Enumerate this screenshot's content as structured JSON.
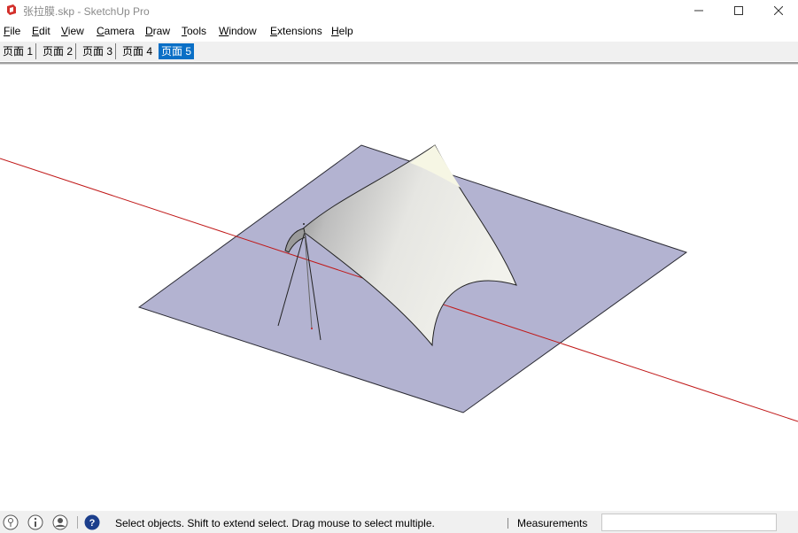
{
  "window": {
    "title": "张拉膜.skp - SketchUp Pro",
    "minimize_glyph": "—",
    "maximize_glyph": "☐",
    "close_glyph": "✕"
  },
  "menu": {
    "items": [
      {
        "accel": "F",
        "rest": "ile"
      },
      {
        "accel": "E",
        "rest": "dit"
      },
      {
        "accel": "V",
        "rest": "iew"
      },
      {
        "accel": "C",
        "rest": "amera"
      },
      {
        "accel": "D",
        "rest": "raw"
      },
      {
        "accel": "T",
        "rest": "ools"
      },
      {
        "accel": "W",
        "rest": "indow"
      },
      {
        "accel": "E",
        "rest": "xtensions"
      },
      {
        "accel": "H",
        "rest": "elp"
      }
    ]
  },
  "tabs": {
    "items": [
      "页面 1",
      "页面 2",
      "页面 3",
      "页面 4",
      "页面 5"
    ],
    "active_index": 4
  },
  "statusbar": {
    "hint": "Select objects. Shift to extend select. Drag mouse to select multiple.",
    "measurements_label": "Measurements",
    "measurements_value": ""
  },
  "icons": [
    "sketchup-logo-icon",
    "geo-location-icon",
    "credits-info-icon",
    "user-account-icon",
    "instructor-help-icon"
  ],
  "colors": {
    "ground_plane": "#b3b3d1",
    "red_axis": "#c01818",
    "membrane_light": "#f4f4e6",
    "membrane_shadow": "#8c8c8c",
    "active_tab": "#0a6fc6"
  }
}
